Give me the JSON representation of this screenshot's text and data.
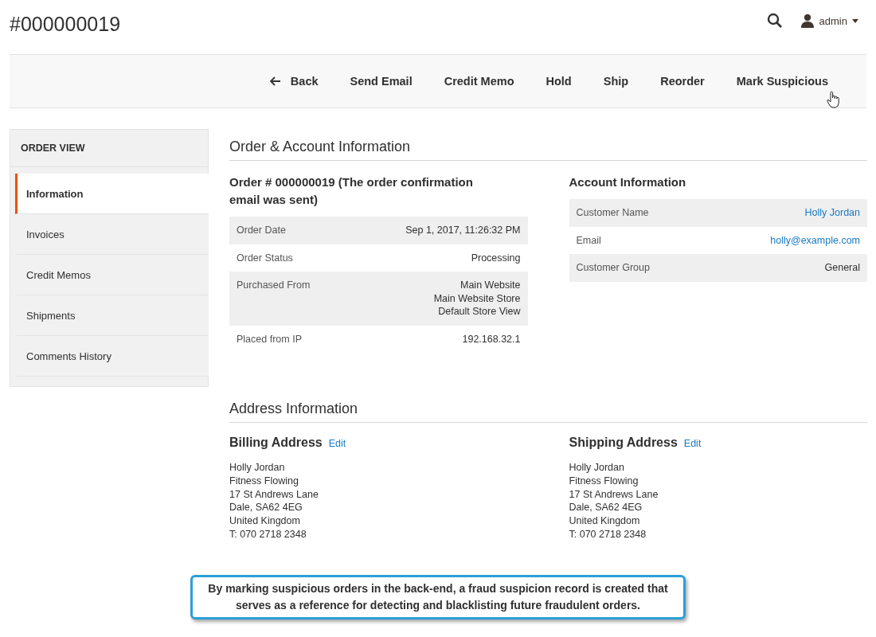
{
  "page_title": "#000000019",
  "header": {
    "user": "admin"
  },
  "toolbar": [
    {
      "label": "Back",
      "kind": "back"
    },
    {
      "label": "Send Email",
      "kind": "plain"
    },
    {
      "label": "Credit Memo",
      "kind": "plain"
    },
    {
      "label": "Hold",
      "kind": "plain"
    },
    {
      "label": "Ship",
      "kind": "plain"
    },
    {
      "label": "Reorder",
      "kind": "plain"
    },
    {
      "label": "Mark Suspicious",
      "kind": "hovered"
    }
  ],
  "sidebar": {
    "title": "ORDER VIEW",
    "items": [
      {
        "label": "Information",
        "selected": true
      },
      {
        "label": "Invoices",
        "selected": false
      },
      {
        "label": "Credit Memos",
        "selected": false
      },
      {
        "label": "Shipments",
        "selected": false
      },
      {
        "label": "Comments History",
        "selected": false
      }
    ]
  },
  "order_section": {
    "title": "Order & Account Information",
    "order": {
      "title": "Order # 000000019 (The order confirmation email was sent)",
      "rows": [
        {
          "label": "Order Date",
          "value": [
            "Sep 1, 2017, 11:26:32 PM"
          ],
          "kind": "text"
        },
        {
          "label": "Order Status",
          "value": [
            "Processing"
          ],
          "kind": "text"
        },
        {
          "label": "Purchased From",
          "value": [
            "Main Website",
            "Main Website Store",
            "Default Store View"
          ],
          "kind": "text"
        },
        {
          "label": "Placed from IP",
          "value": [
            "192.168.32.1"
          ],
          "kind": "text"
        }
      ]
    },
    "account": {
      "title": "Account Information",
      "rows": [
        {
          "label": "Customer Name",
          "value": [
            "Holly Jordan"
          ],
          "kind": "link"
        },
        {
          "label": "Email",
          "value": [
            "holly@example.com"
          ],
          "kind": "link"
        },
        {
          "label": "Customer Group",
          "value": [
            "General"
          ],
          "kind": "text"
        }
      ]
    }
  },
  "address_section": {
    "title": "Address Information",
    "addresses": [
      {
        "title": "Billing Address",
        "edit": "Edit",
        "lines": [
          "Holly Jordan",
          "Fitness Flowing",
          "17 St Andrews Lane",
          "Dale, SA62 4EG",
          "United Kingdom",
          "T: 070 2718 2348"
        ]
      },
      {
        "title": "Shipping Address",
        "edit": "Edit",
        "lines": [
          "Holly Jordan",
          "Fitness Flowing",
          "17 St Andrews Lane",
          "Dale, SA62 4EG",
          "United Kingdom",
          "T: 070 2718 2348"
        ]
      }
    ]
  },
  "callout": "By marking suspicious orders in the back-end, a fraud suspicion record is created that serves as a reference for detecting and blacklisting future fraudulent orders."
}
